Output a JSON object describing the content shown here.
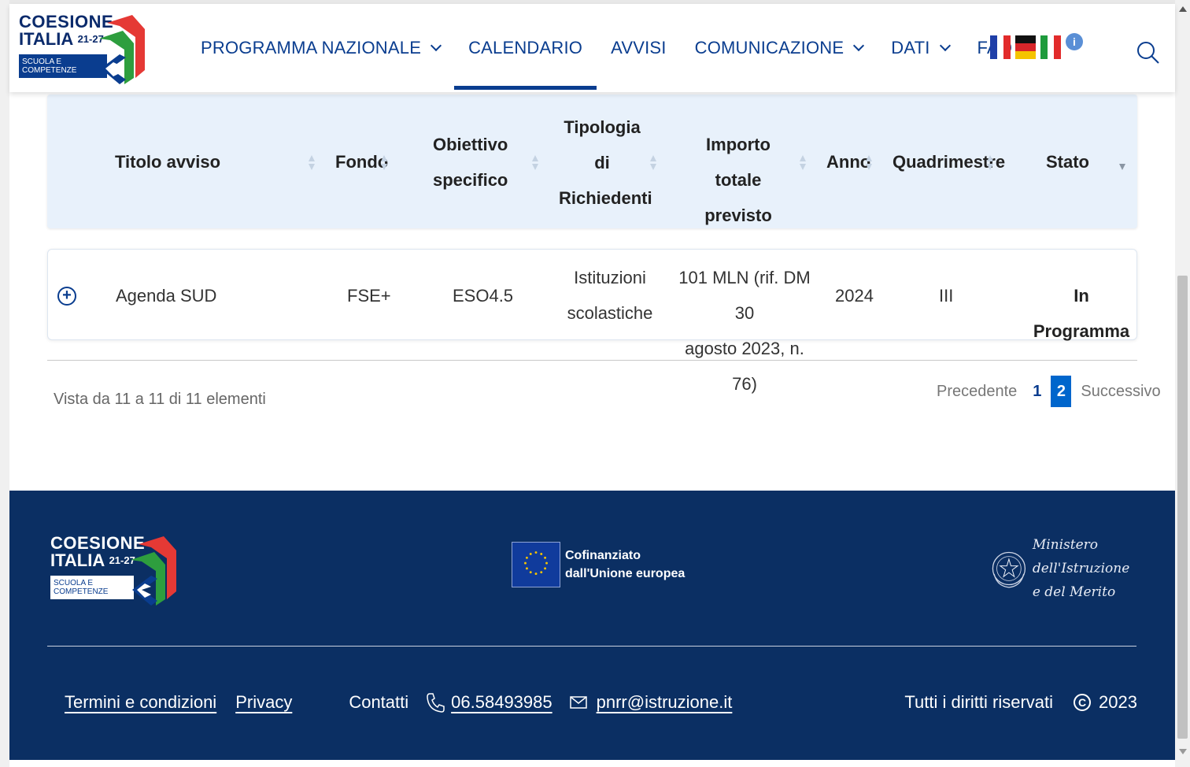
{
  "header": {
    "logo": {
      "line1": "COESIONE",
      "line2": "ITALIA",
      "sup": "21-27",
      "box_line1": "SCUOLA E",
      "box_line2": "COMPETENZE"
    },
    "nav": [
      {
        "label": "PROGRAMMA NAZIONALE",
        "dropdown": true,
        "active": false
      },
      {
        "label": "CALENDARIO",
        "dropdown": false,
        "active": true
      },
      {
        "label": "AVVISI",
        "dropdown": false,
        "active": false
      },
      {
        "label": "COMUNICAZIONE",
        "dropdown": true,
        "active": false
      },
      {
        "label": "DATI",
        "dropdown": true,
        "active": false
      },
      {
        "label": "FAQ",
        "dropdown": false,
        "active": false
      }
    ],
    "info_symbol": "i",
    "icons": [
      "flag-france-icon",
      "flag-germany-icon",
      "flag-italy-icon",
      "info-icon",
      "search-icon"
    ]
  },
  "table": {
    "columns": [
      {
        "label": "Titolo avviso"
      },
      {
        "label": "Fondo"
      },
      {
        "label_lines": [
          "Obiettivo",
          "specifico"
        ]
      },
      {
        "label_lines": [
          "Tipologia",
          "di",
          "Richiedenti"
        ]
      },
      {
        "label_lines": [
          "Importo totale",
          "previsto"
        ]
      },
      {
        "label": "Anno"
      },
      {
        "label": "Quadrimestre"
      },
      {
        "label": "Stato"
      }
    ],
    "rows": [
      {
        "titolo": "Agenda SUD",
        "fondo": "FSE+",
        "obiettivo": "ESO4.5",
        "tipologia_lines": [
          "Istituzioni",
          "scolastiche"
        ],
        "importo_lines": [
          "101 MLN (rif. DM 30",
          "agosto 2023, n. 76)"
        ],
        "anno": "2024",
        "quadrimestre": "III",
        "stato": "In Programma"
      }
    ],
    "info": "Vista da 11 a 11 di 11 elementi",
    "pagination": {
      "prev": "Precedente",
      "pages": [
        "1",
        "2"
      ],
      "current": "2",
      "next": "Successivo"
    }
  },
  "footer": {
    "logo": {
      "line1": "COESIONE",
      "line2": "ITALIA",
      "sup": "21-27",
      "box_line1": "SCUOLA E",
      "box_line2": "COMPETENZE"
    },
    "eu_line1": "Cofinanziato",
    "eu_line2": "dall'Unione europea",
    "ministry_line1": "Ministero dell'Istruzione",
    "ministry_line2": "e del Merito",
    "links": {
      "terms": "Termini e condizioni",
      "privacy": "Privacy",
      "contacts": "Contatti",
      "phone": "06.58493985",
      "email": "pnrr@istruzione.it"
    },
    "rights": "Tutti i diritti riservati",
    "copyright_symbol": "C",
    "year": "2023"
  },
  "colors": {
    "brand_blue": "#0a3d8f",
    "footer_bg": "#0b2f63",
    "header_row_bg": "#e8f1fb",
    "active_page": "#0066cc"
  }
}
